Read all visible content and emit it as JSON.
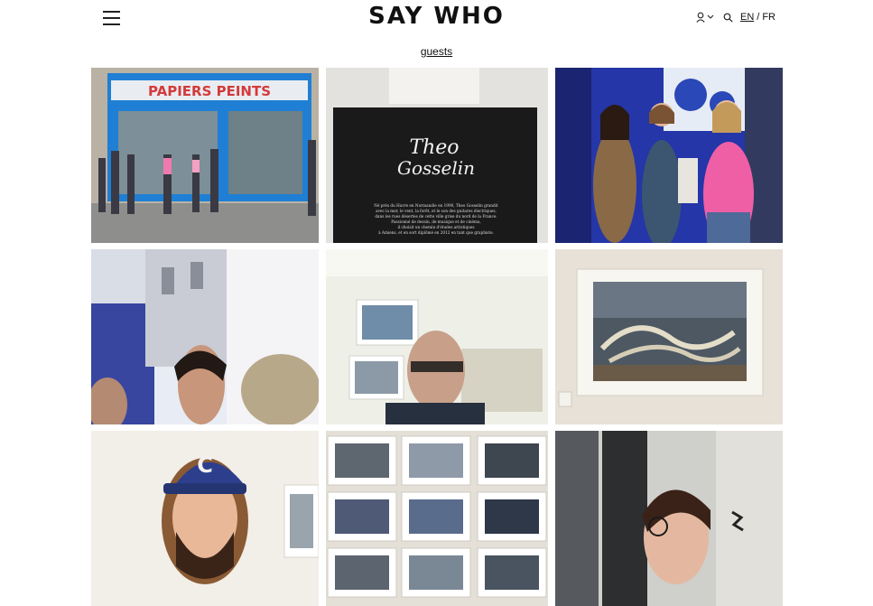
{
  "header": {
    "logo": "SAY WHO",
    "menu_icon": "hamburger-icon",
    "user_icon": "user-icon",
    "search_icon": "search-icon",
    "lang_en": "EN",
    "lang_separator": "/",
    "lang_fr": "FR"
  },
  "subnav": {
    "label": "guests"
  },
  "gallery": {
    "tiles": [
      {
        "sign": "PAPIERS PEINTS"
      },
      {
        "sign_line1": "Theo",
        "sign_line2": "Gosselin",
        "caption1": "Né près du Havre en Normandie en 1990, Theo Gosselin grandit",
        "caption2": "avec la mer, le vent, la forêt, et le son des guitares électriques,",
        "caption3": "dans les rues désertes de cette ville grise du nord de la France.",
        "caption4": "Passionné de dessin, de musique et de cinéma,",
        "caption5": "il choisit un chemin d'études artistiques",
        "caption6": "à Amiens, et en sort diplômé en 2012 en tant que graphiste."
      },
      {},
      {},
      {},
      {},
      {
        "cap_letter": "C"
      },
      {},
      {}
    ]
  },
  "colors": {
    "blue_storefront": "#1f7fd4",
    "sign_red": "#d43a3a",
    "cap_blue": "#2d3f8c"
  }
}
